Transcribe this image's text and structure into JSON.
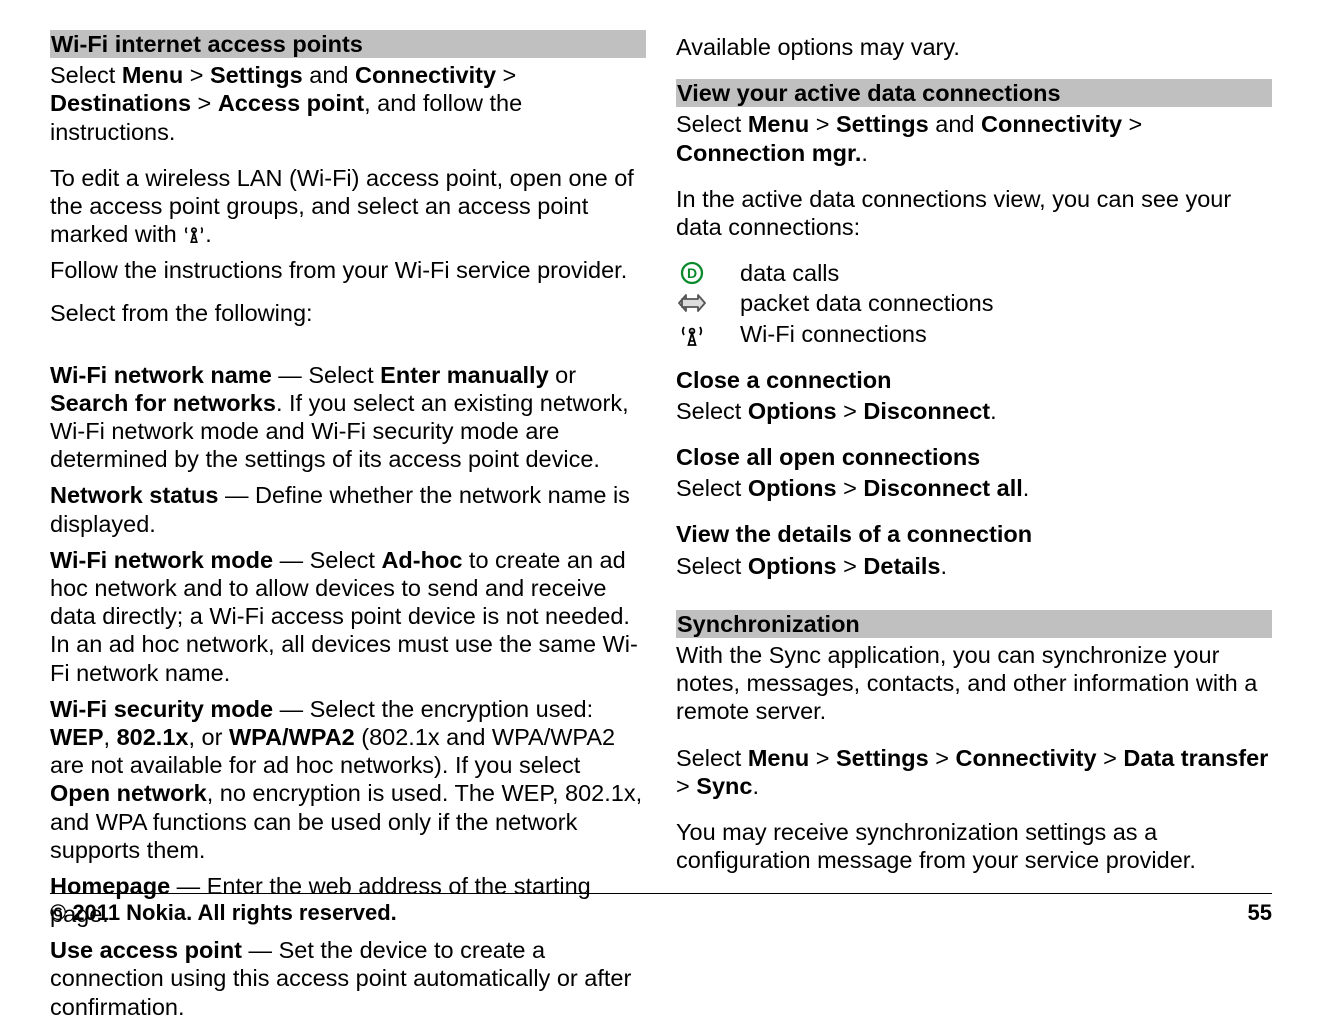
{
  "left": {
    "heading1": "Wi-Fi internet access points",
    "p1_pre": "Select ",
    "menu": "Menu",
    "gt": " > ",
    "settings": "Settings",
    "and": " and ",
    "connectivity": "Connectivity",
    "destinations": "Destinations",
    "access_point": "Access point",
    "p1_post": ", and follow the instructions.",
    "p2a": "To edit a wireless LAN (Wi-Fi) access point, open one of the access point groups, and select an access point marked with ",
    "p2b": ".",
    "p3": "Follow the instructions from your Wi-Fi service provider.",
    "p4": "Select from the following:",
    "defs": {
      "name_lbl": "Wi-Fi network name",
      "name_txt_pre": "  —  Select ",
      "enter_manually": "Enter manually",
      "or": " or ",
      "search_networks": "Search for networks",
      "name_txt_post": ". If you select an existing network, Wi-Fi network mode and Wi-Fi security mode are determined by the settings of its access point device.",
      "status_lbl": "Network status",
      "status_txt": "  —  Define whether the network name is displayed.",
      "mode_lbl": "Wi-Fi network mode",
      "mode_pre": "  —  Select ",
      "adhoc": "Ad-hoc",
      "mode_post": " to create an ad hoc network and to allow devices to send and receive data directly; a Wi-Fi access point device is not needed. In an ad hoc network, all devices must use the same Wi-Fi network name.",
      "sec_lbl": "Wi-Fi security mode",
      "sec_pre": "  —  Select the encryption used: ",
      "wep": "WEP",
      "comma": ", ",
      "8021x": "802.1x",
      "comma_or": ", or ",
      "wpa": "WPA/WPA2",
      "sec_mid": " (802.1x and WPA/WPA2 are not available for ad hoc networks). If you select ",
      "open_network": "Open network",
      "sec_post": ", no encryption is used. The WEP, 802.1x, and WPA functions can be used only if the network supports them.",
      "home_lbl": "Homepage",
      "home_txt": "  —  Enter the web address of the starting page.",
      "uap_lbl": "Use access point",
      "uap_txt": "  —  Set the device to create a connection using this access point automatically or after confirmation."
    }
  },
  "right": {
    "p1": "Available options may vary.",
    "heading1": "View your active data connections",
    "p2_pre": "Select ",
    "menu": "Menu",
    "gt": " > ",
    "settings": "Settings",
    "and": " and ",
    "connectivity": "Connectivity",
    "conn_mgr": "Connection mgr.",
    "p2_post": ".",
    "p3": "In the active data connections view, you can see your data connections:",
    "icons": {
      "data_calls": "data calls",
      "packet": "packet data connections",
      "wifi": "Wi-Fi connections"
    },
    "close_conn_h": "Close a connection",
    "close_conn_pre": "Select ",
    "options": "Options",
    "disconnect": "Disconnect",
    "period": ".",
    "close_all_h": "Close all open connections",
    "disconnect_all": "Disconnect all",
    "view_details_h": "View the details of a connection",
    "details": "Details",
    "sync_h": "Synchronization",
    "sync_p1": "With the Sync application, you can synchronize your notes, messages, contacts, and other information with a remote server.",
    "sync_p2_pre": "Select ",
    "data_transfer": "Data transfer",
    "sync": "Sync",
    "sync_p3": "You may receive synchronization settings as a configuration message from your service provider."
  },
  "footer": {
    "left": "© 2011 Nokia. All rights reserved.",
    "right": "55"
  }
}
